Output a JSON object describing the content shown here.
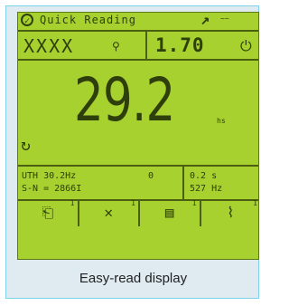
{
  "screen": {
    "title": "Quick Reading",
    "title_extra": "~~",
    "nav_arrow": "↗",
    "status_icon": "✓"
  },
  "row2": {
    "id": "XXXX",
    "pin_icon": "⚲",
    "ratio": "1.70",
    "power_icon": "⏻"
  },
  "reading": {
    "value": "29.2",
    "unit": "hs"
  },
  "refresh_icon": "↻",
  "info": {
    "line1_left": "UTH  30.2Hz",
    "line2_left": "S-N = 2866I",
    "mid": "0",
    "line1_right": "0.2 s",
    "line2_right": "527 Hz"
  },
  "softkeys": [
    {
      "icon": "⎗",
      "num": "1"
    },
    {
      "icon": "✕",
      "num": "1"
    },
    {
      "icon": "▤",
      "num": "1"
    },
    {
      "icon": "⌇",
      "num": "1"
    }
  ],
  "caption": "Easy-read display",
  "colors": {
    "lcd": "#a6d12e",
    "ink": "#2f3f0c",
    "card": "#dfeaf1",
    "border": "#7fd3e8"
  }
}
